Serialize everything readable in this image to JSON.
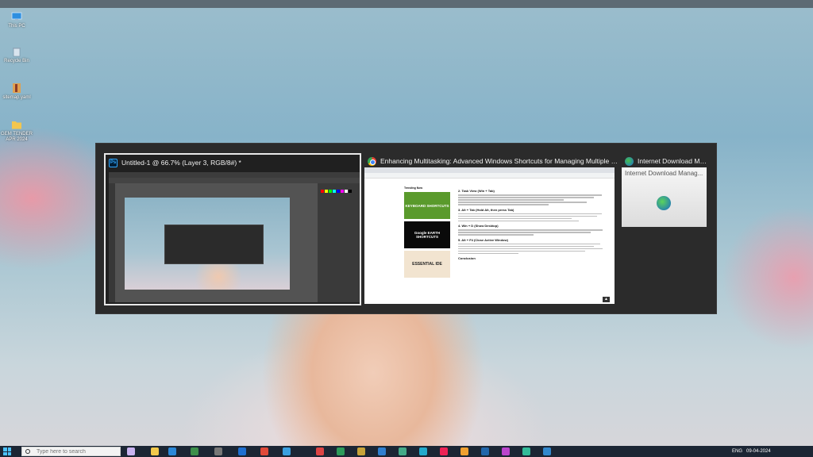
{
  "desktop": {
    "icons": [
      {
        "label": "This PC",
        "icon": "monitor-icon"
      },
      {
        "label": "Recycle Bin",
        "icon": "recycle-bin-icon"
      },
      {
        "label": "sitemap.yaml",
        "icon": "folder-icon"
      },
      {
        "label": "GEM TENDER APR 2024",
        "icon": "folder-icon"
      }
    ]
  },
  "switcher": {
    "windows": [
      {
        "title": "Untitled-1 @ 66.7% (Layer 3, RGB/8#) *",
        "app": "Photoshop",
        "icon": "photoshop-icon",
        "selected": true
      },
      {
        "title": "Enhancing Multitasking: Advanced Windows Shortcuts for Managing Multiple Windows and Applica...",
        "app": "Chrome",
        "icon": "chrome-icon",
        "selected": false
      },
      {
        "title": "Internet Download Mana...",
        "app": "Internet Download Manager",
        "icon": "idm-icon",
        "selected": false
      }
    ],
    "chrome_page": {
      "trending": "Trending Now",
      "cards": [
        "KEYBOARD SHORTCUTS",
        "Google EARTH SHORTCUTS",
        "ESSENTIAL IDE"
      ],
      "headings": [
        "2. Task View (Win + Tab)",
        "3. Alt + Tab (Hold Alt, then press Tab)",
        "4. Win + D (Show Desktop)",
        "5. Alt + F4 (Close Active Window)",
        "Conclusion"
      ]
    },
    "idm_window": {
      "inner_title": "Internet Download Manag..."
    }
  },
  "taskbar": {
    "search_placeholder": "Type here to search",
    "tray_lang": "ENG",
    "date": "09-04-2024"
  },
  "colors": {
    "taskbar": "#1c2634",
    "switcher_bg": "#2b2b2b",
    "accent": "#4cc2ff"
  }
}
